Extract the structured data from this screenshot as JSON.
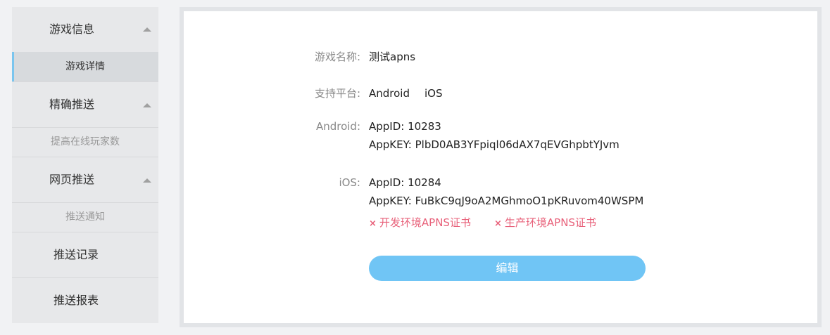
{
  "sidebar": {
    "game_info": {
      "label": "游戏信息",
      "sub": "游戏详情"
    },
    "precise_push": {
      "label": "精确推送",
      "sub": "提高在线玩家数"
    },
    "web_push": {
      "label": "网页推送",
      "sub": "推送通知"
    },
    "push_records": {
      "label": "推送记录"
    },
    "push_reports": {
      "label": "推送报表"
    },
    "active_color": "#7ac5ee"
  },
  "detail": {
    "game_name_label": "游戏名称:",
    "game_name_value": "测试apns",
    "platform_label": "支持平台:",
    "platform_android": "Android",
    "platform_ios": "iOS",
    "android_label": "Android:",
    "android_appid": "AppID: 10283",
    "android_appkey": "AppKEY: PlbD0AB3YFpiql06dAX7qEVGhpbtYJvm",
    "ios_label": "iOS:",
    "ios_appid": "AppID: 10284",
    "ios_appkey": "AppKEY: FuBkC9qJ9oA2MGhmoO1pKRuvom40WSPM",
    "dev_cert": "开发环境APNS证书",
    "prod_cert": "生产环境APNS证书",
    "cert_missing_icon": "close-icon",
    "cert_color": "#e8617a",
    "edit_button": "编辑",
    "edit_button_color": "#70c5f5"
  }
}
